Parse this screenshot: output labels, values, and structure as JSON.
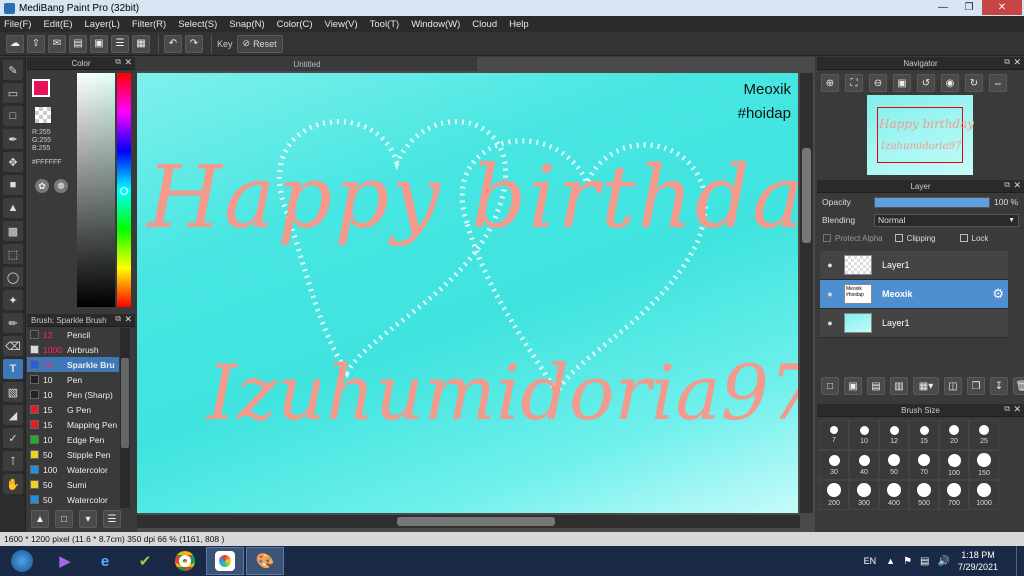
{
  "window": {
    "title": "MediBang Paint Pro (32bit)"
  },
  "menu": [
    "File(F)",
    "Edit(E)",
    "Layer(L)",
    "Filter(R)",
    "Select(S)",
    "Snap(N)",
    "Color(C)",
    "View(V)",
    "Tool(T)",
    "Window(W)",
    "Cloud",
    "Help"
  ],
  "toolbar": {
    "key_label": "Key",
    "reset_label": "Reset"
  },
  "color_panel": {
    "title": "Color",
    "r": "R:255",
    "g": "G:255",
    "b": "B:255",
    "hex": "#FFFFFF",
    "primary": "#e8115b",
    "secondary": "#ffffff"
  },
  "document": {
    "tab": "Untitled"
  },
  "canvas": {
    "watermark_name": "Meoxik",
    "watermark_tag": "#hoidap",
    "line1": "Happy birthday",
    "line2": "Izuhumidoria97",
    "text_color": "#f39a8c"
  },
  "brush_panel": {
    "title": "Brush: Sparkle Brush",
    "items": [
      {
        "size": "12",
        "name": "Pencil",
        "color": "#333333"
      },
      {
        "size": "1000",
        "name": "Airbrush",
        "color": "#d9d9d9"
      },
      {
        "size": "70",
        "name": "Sparkle Bru",
        "color": "#2b5cd9"
      },
      {
        "size": "10",
        "name": "Pen",
        "color": "#222222"
      },
      {
        "size": "10",
        "name": "Pen (Sharp)",
        "color": "#222222"
      },
      {
        "size": "15",
        "name": "G Pen",
        "color": "#e02020"
      },
      {
        "size": "15",
        "name": "Mapping Pen",
        "color": "#e02020"
      },
      {
        "size": "10",
        "name": "Edge Pen",
        "color": "#22b022"
      },
      {
        "size": "50",
        "name": "Stipple Pen",
        "color": "#f0d020"
      },
      {
        "size": "100",
        "name": "Watercolor",
        "color": "#2090e0"
      },
      {
        "size": "50",
        "name": "Sumi",
        "color": "#f0d020"
      },
      {
        "size": "50",
        "name": "Watercolor",
        "color": "#2090e0"
      }
    ]
  },
  "navigator": {
    "title": "Navigator"
  },
  "layer_panel": {
    "title": "Layer",
    "opacity_label": "Opacity",
    "opacity_value": "100 %",
    "opacity_fraction": 1.0,
    "blending_label": "Blending",
    "blending_value": "Normal",
    "protect_alpha": "Protect Alpha",
    "clipping": "Clipping",
    "lock": "Lock",
    "layers": [
      {
        "name": "Layer1",
        "selected": false
      },
      {
        "name": "Meoxik",
        "selected": true
      },
      {
        "name": "Layer1",
        "selected": false
      }
    ],
    "thumb_text": "Meoxik #hoidap"
  },
  "brush_size": {
    "title": "Brush Size",
    "sizes": [
      "7",
      "10",
      "12",
      "15",
      "20",
      "25",
      "30",
      "40",
      "50",
      "70",
      "100",
      "150",
      "200",
      "300",
      "400",
      "500",
      "700",
      "1000"
    ]
  },
  "status": {
    "text": "1600 * 1200 pixel  (11.6 * 8.7cm)  350 dpi  66 %  (1161, 808 )"
  },
  "taskbar": {
    "lang": "EN",
    "time": "1:18 PM",
    "date": "7/29/2021"
  }
}
